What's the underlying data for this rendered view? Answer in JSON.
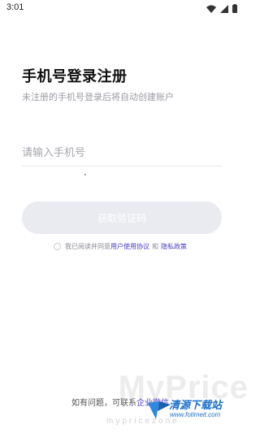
{
  "status_bar": {
    "time": "3:01",
    "icons": [
      "wifi-icon",
      "signal-icon",
      "battery-icon"
    ]
  },
  "login": {
    "title": "手机号登录注册",
    "subtitle": "未注册的手机号登录后将自动创建账户",
    "phone_placeholder": "请输入手机号",
    "code_button": "获取验证码"
  },
  "agreement": {
    "prefix": "我已阅读并同意",
    "user_agreement": "用户使用协议",
    "and": "和",
    "privacy_policy": "隐私政策"
  },
  "contact": {
    "prefix": "如有问题，可联系",
    "link": "企业微信"
  },
  "watermark": {
    "big_text": "MyPrice",
    "small_text": "mypricezone",
    "logo_text": "清源下载站",
    "logo_sub": "www.fotimeit.com"
  },
  "colors": {
    "accent": "#4b3cc9",
    "button_disabled": "#e9ebf0"
  }
}
